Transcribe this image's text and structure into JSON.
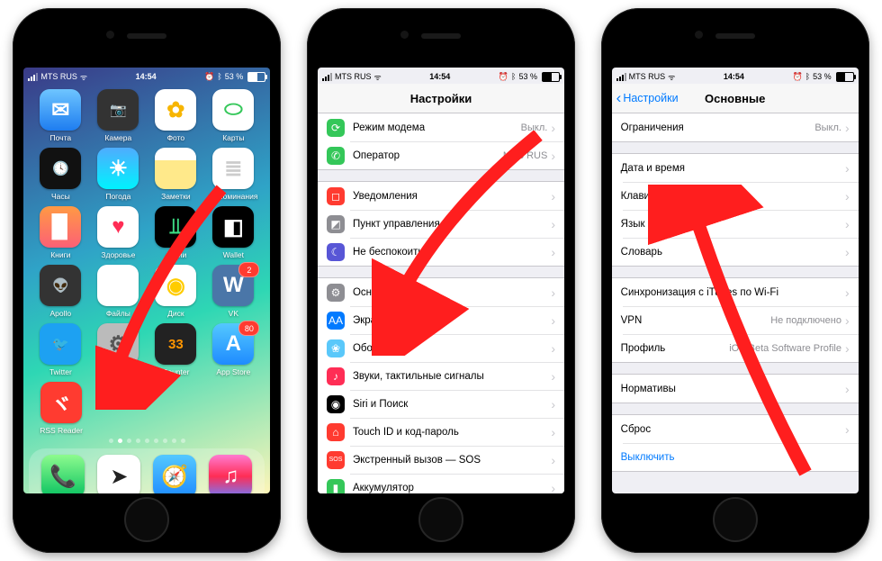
{
  "status": {
    "carrier": "MTS RUS",
    "wifi": "ᯤ",
    "time": "14:54",
    "alarm": "⏰",
    "bt": "ᛒ",
    "batt": "53 %"
  },
  "home": {
    "apps_row1": [
      {
        "label": "Почта",
        "bg": "linear-gradient(#6ec5ff,#1e7df0)",
        "glyph": "✉"
      },
      {
        "label": "Камера",
        "bg": "#333",
        "glyph": "📷"
      },
      {
        "label": "Фото",
        "bg": "#fff",
        "glyph": "✿",
        "fg": "#f7b500"
      },
      {
        "label": "Карты",
        "bg": "#fff",
        "glyph": "⬭",
        "fg": "#34c759"
      }
    ],
    "apps_row2": [
      {
        "label": "Часы",
        "bg": "#111",
        "glyph": "🕓"
      },
      {
        "label": "Погода",
        "bg": "linear-gradient(#4facfe,#00f2fe)",
        "glyph": "☀"
      },
      {
        "label": "Заметки",
        "bg": "linear-gradient(#fff 30%,#ffe98a 30%)",
        "glyph": ""
      },
      {
        "label": "Напоминания",
        "bg": "#fff",
        "glyph": "≣",
        "fg": "#ccc"
      }
    ],
    "apps_row3": [
      {
        "label": "Книги",
        "bg": "linear-gradient(#ff9a44,#fc6076)",
        "glyph": "▉"
      },
      {
        "label": "Здоровье",
        "bg": "#fff",
        "glyph": "♥",
        "fg": "#ff2d55"
      },
      {
        "label": "Акции",
        "bg": "#000",
        "glyph": "⫫",
        "fg": "#3ddc84"
      },
      {
        "label": "Wallet",
        "bg": "#000",
        "glyph": "◧"
      }
    ],
    "apps_row4": [
      {
        "label": "Apollo",
        "bg": "#333",
        "glyph": "👽"
      },
      {
        "label": "Файлы",
        "bg": "#fff",
        "glyph": "🗂"
      },
      {
        "label": "Диск",
        "bg": "#fff",
        "glyph": "◉",
        "fg": "#ffcc00"
      },
      {
        "label": "VK",
        "bg": "#4a76a8",
        "glyph": "W",
        "badge": "2"
      }
    ],
    "apps_row5": [
      {
        "label": "Twitter",
        "bg": "#1da1f2",
        "glyph": "🐦"
      },
      {
        "label": "Настройки",
        "bg": "#bbb",
        "glyph": "⚙",
        "fg": "#555"
      },
      {
        "label": "Counter",
        "bg": "#222",
        "glyph": "33",
        "fg": "#ff9500"
      },
      {
        "label": "App Store",
        "bg": "linear-gradient(#54c8ff,#1e8bff)",
        "glyph": "A",
        "badge": "80"
      }
    ],
    "apps_row6": [
      {
        "label": "RSS Reader",
        "bg": "#ff3b30",
        "glyph": "ヾ"
      }
    ],
    "dock": [
      {
        "bg": "linear-gradient(#8dfb8e,#07c160)",
        "glyph": "📞"
      },
      {
        "bg": "#fff",
        "glyph": "➤",
        "fg": "#222"
      },
      {
        "bg": "linear-gradient(#54c8ff,#1e8bff)",
        "glyph": "🧭"
      },
      {
        "bg": "linear-gradient(#ff7bd1,#ff2d55,#6e7bff)",
        "glyph": "♫"
      }
    ]
  },
  "settings": {
    "title": "Настройки",
    "g1": [
      {
        "icon_bg": "#34c759",
        "glyph": "⟳",
        "label": "Режим модема",
        "val": "Выкл."
      },
      {
        "icon_bg": "#34c759",
        "glyph": "✆",
        "label": "Оператор",
        "val": "MTS RUS"
      }
    ],
    "g2": [
      {
        "icon_bg": "#ff3b30",
        "glyph": "◻",
        "label": "Уведомления"
      },
      {
        "icon_bg": "#8e8e93",
        "glyph": "◩",
        "label": "Пункт управления"
      },
      {
        "icon_bg": "#5856d6",
        "glyph": "☾",
        "label": "Не беспокоить"
      }
    ],
    "g3": [
      {
        "icon_bg": "#8e8e93",
        "glyph": "⚙",
        "label": "Основные"
      },
      {
        "icon_bg": "#007aff",
        "glyph": "AA",
        "label": "Экран и яркость"
      },
      {
        "icon_bg": "#5ac8fa",
        "glyph": "❀",
        "label": "Обои"
      },
      {
        "icon_bg": "#ff2d55",
        "glyph": "♪",
        "label": "Звуки, тактильные сигналы"
      },
      {
        "icon_bg": "#000",
        "glyph": "◉",
        "label": "Siri и Поиск"
      },
      {
        "icon_bg": "#ff3b30",
        "glyph": "⌂",
        "label": "Touch ID и код-пароль"
      },
      {
        "icon_bg": "#ff3b30",
        "glyph": "SOS",
        "label": "Экстренный вызов — SOS"
      },
      {
        "icon_bg": "#34c759",
        "glyph": "▮",
        "label": "Аккумулятор"
      }
    ]
  },
  "general": {
    "back": "Настройки",
    "title": "Основные",
    "g1": [
      {
        "label": "Ограничения",
        "val": "Выкл."
      }
    ],
    "g2": [
      {
        "label": "Дата и время"
      },
      {
        "label": "Клавиатура"
      },
      {
        "label": "Язык и регион"
      },
      {
        "label": "Словарь"
      }
    ],
    "g3": [
      {
        "label": "Синхронизация с iTunes по Wi-Fi"
      },
      {
        "label": "VPN",
        "val": "Не подключено"
      },
      {
        "label": "Профиль",
        "val": "iOS Beta Software Profile"
      }
    ],
    "g4": [
      {
        "label": "Нормативы"
      }
    ],
    "g5": [
      {
        "label": "Сброс"
      },
      {
        "label": "Выключить",
        "link": true
      }
    ]
  }
}
